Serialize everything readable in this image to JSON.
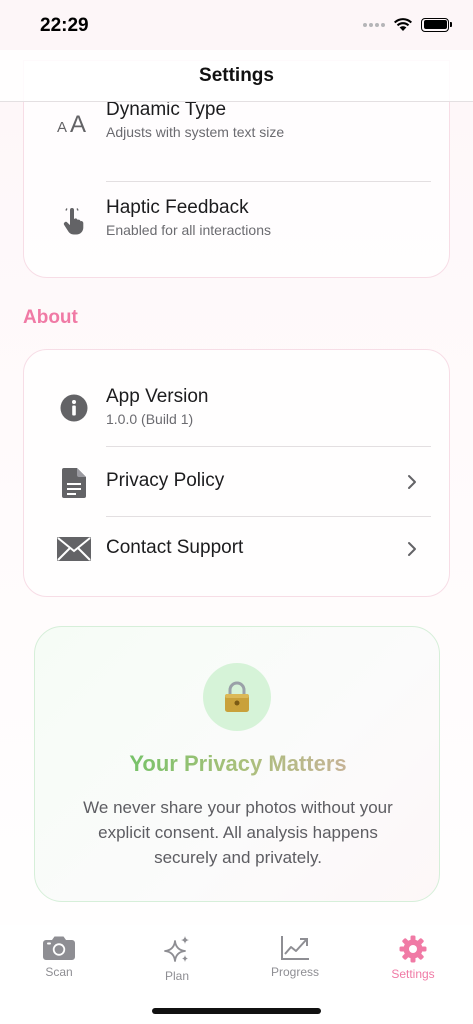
{
  "status_bar": {
    "time": "22:29"
  },
  "nav": {
    "title": "Settings"
  },
  "accessibility_rows": [
    {
      "title": "Dynamic Type",
      "subtitle": "Adjusts with system text size",
      "icon": "text-size-icon"
    },
    {
      "title": "Haptic Feedback",
      "subtitle": "Enabled for all interactions",
      "icon": "hand-tap-icon"
    }
  ],
  "about": {
    "header": "About",
    "rows": [
      {
        "title": "App Version",
        "subtitle": "1.0.0 (Build 1)",
        "icon": "info-icon"
      },
      {
        "title": "Privacy Policy",
        "icon": "document-icon",
        "chevron": true
      },
      {
        "title": "Contact Support",
        "icon": "envelope-icon",
        "chevron": true
      }
    ]
  },
  "privacy_card": {
    "icon": "lock-icon",
    "title": "Your Privacy Matters",
    "body": "We never share your photos without your explicit consent. All analysis happens securely and privately."
  },
  "tabs": [
    {
      "label": "Scan",
      "icon": "camera-icon",
      "active": false
    },
    {
      "label": "Plan",
      "icon": "sparkles-icon",
      "active": false
    },
    {
      "label": "Progress",
      "icon": "chart-line-icon",
      "active": false
    },
    {
      "label": "Settings",
      "icon": "gear-icon",
      "active": true
    }
  ],
  "colors": {
    "accent": "#f07aa5",
    "privacy_green": "#4cc45a",
    "lock_bg": "#d6f3d8"
  }
}
